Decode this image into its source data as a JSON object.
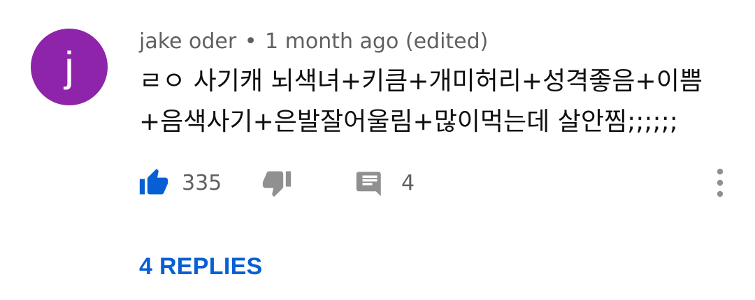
{
  "comment": {
    "author": {
      "name": "jake oder",
      "avatar_letter": "j",
      "avatar_color": "#8e24aa"
    },
    "separator": "•",
    "timestamp": "1 month ago",
    "edited_label": "(edited)",
    "text_lines": [
      "ㄹㅇ 사기캐 뇌색녀+키큼+개미허리+성격좋음+이쁨",
      "+음색사기+은발잘어울림+많이먹는데 살안찜;;;;;;"
    ],
    "actions": {
      "like_count": "335",
      "reply_count": "4",
      "like_icon": "thumb-up-filled-icon",
      "dislike_icon": "thumb-down-icon",
      "reply_icon": "comment-icon",
      "more_icon": "more-vertical-icon",
      "like_color": "#065fd4",
      "icon_color": "#909090"
    },
    "replies_label": "4 REPLIES",
    "replies_color": "#065fd4"
  }
}
